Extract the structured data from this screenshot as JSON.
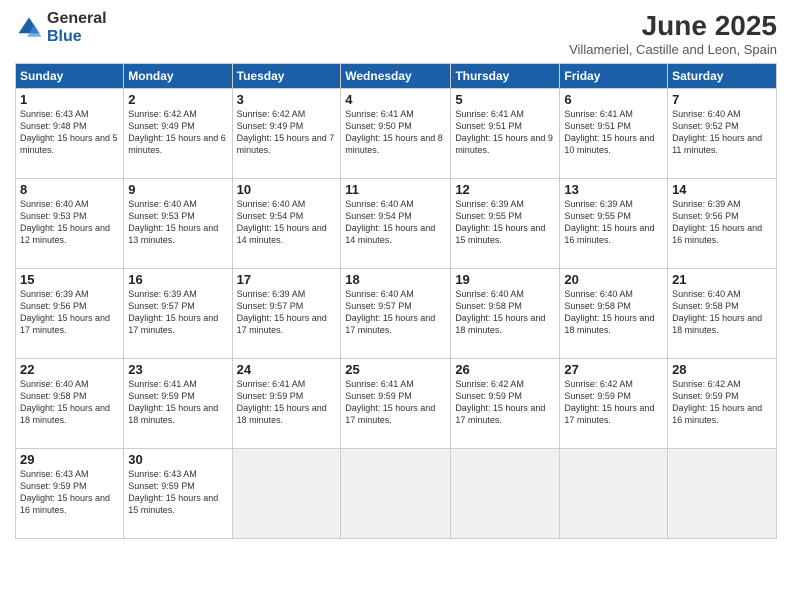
{
  "logo": {
    "general": "General",
    "blue": "Blue"
  },
  "title": "June 2025",
  "subtitle": "Villameriel, Castille and Leon, Spain",
  "days_of_week": [
    "Sunday",
    "Monday",
    "Tuesday",
    "Wednesday",
    "Thursday",
    "Friday",
    "Saturday"
  ],
  "weeks": [
    [
      {
        "day": "1",
        "sunrise": "6:43 AM",
        "sunset": "9:48 PM",
        "daylight": "15 hours and 5 minutes."
      },
      {
        "day": "2",
        "sunrise": "6:42 AM",
        "sunset": "9:49 PM",
        "daylight": "15 hours and 6 minutes."
      },
      {
        "day": "3",
        "sunrise": "6:42 AM",
        "sunset": "9:49 PM",
        "daylight": "15 hours and 7 minutes."
      },
      {
        "day": "4",
        "sunrise": "6:41 AM",
        "sunset": "9:50 PM",
        "daylight": "15 hours and 8 minutes."
      },
      {
        "day": "5",
        "sunrise": "6:41 AM",
        "sunset": "9:51 PM",
        "daylight": "15 hours and 9 minutes."
      },
      {
        "day": "6",
        "sunrise": "6:41 AM",
        "sunset": "9:51 PM",
        "daylight": "15 hours and 10 minutes."
      },
      {
        "day": "7",
        "sunrise": "6:40 AM",
        "sunset": "9:52 PM",
        "daylight": "15 hours and 11 minutes."
      }
    ],
    [
      {
        "day": "8",
        "sunrise": "6:40 AM",
        "sunset": "9:53 PM",
        "daylight": "15 hours and 12 minutes."
      },
      {
        "day": "9",
        "sunrise": "6:40 AM",
        "sunset": "9:53 PM",
        "daylight": "15 hours and 13 minutes."
      },
      {
        "day": "10",
        "sunrise": "6:40 AM",
        "sunset": "9:54 PM",
        "daylight": "15 hours and 14 minutes."
      },
      {
        "day": "11",
        "sunrise": "6:40 AM",
        "sunset": "9:54 PM",
        "daylight": "15 hours and 14 minutes."
      },
      {
        "day": "12",
        "sunrise": "6:39 AM",
        "sunset": "9:55 PM",
        "daylight": "15 hours and 15 minutes."
      },
      {
        "day": "13",
        "sunrise": "6:39 AM",
        "sunset": "9:55 PM",
        "daylight": "15 hours and 16 minutes."
      },
      {
        "day": "14",
        "sunrise": "6:39 AM",
        "sunset": "9:56 PM",
        "daylight": "15 hours and 16 minutes."
      }
    ],
    [
      {
        "day": "15",
        "sunrise": "6:39 AM",
        "sunset": "9:56 PM",
        "daylight": "15 hours and 17 minutes."
      },
      {
        "day": "16",
        "sunrise": "6:39 AM",
        "sunset": "9:57 PM",
        "daylight": "15 hours and 17 minutes."
      },
      {
        "day": "17",
        "sunrise": "6:39 AM",
        "sunset": "9:57 PM",
        "daylight": "15 hours and 17 minutes."
      },
      {
        "day": "18",
        "sunrise": "6:40 AM",
        "sunset": "9:57 PM",
        "daylight": "15 hours and 17 minutes."
      },
      {
        "day": "19",
        "sunrise": "6:40 AM",
        "sunset": "9:58 PM",
        "daylight": "15 hours and 18 minutes."
      },
      {
        "day": "20",
        "sunrise": "6:40 AM",
        "sunset": "9:58 PM",
        "daylight": "15 hours and 18 minutes."
      },
      {
        "day": "21",
        "sunrise": "6:40 AM",
        "sunset": "9:58 PM",
        "daylight": "15 hours and 18 minutes."
      }
    ],
    [
      {
        "day": "22",
        "sunrise": "6:40 AM",
        "sunset": "9:58 PM",
        "daylight": "15 hours and 18 minutes."
      },
      {
        "day": "23",
        "sunrise": "6:41 AM",
        "sunset": "9:59 PM",
        "daylight": "15 hours and 18 minutes."
      },
      {
        "day": "24",
        "sunrise": "6:41 AM",
        "sunset": "9:59 PM",
        "daylight": "15 hours and 18 minutes."
      },
      {
        "day": "25",
        "sunrise": "6:41 AM",
        "sunset": "9:59 PM",
        "daylight": "15 hours and 17 minutes."
      },
      {
        "day": "26",
        "sunrise": "6:42 AM",
        "sunset": "9:59 PM",
        "daylight": "15 hours and 17 minutes."
      },
      {
        "day": "27",
        "sunrise": "6:42 AM",
        "sunset": "9:59 PM",
        "daylight": "15 hours and 17 minutes."
      },
      {
        "day": "28",
        "sunrise": "6:42 AM",
        "sunset": "9:59 PM",
        "daylight": "15 hours and 16 minutes."
      }
    ],
    [
      {
        "day": "29",
        "sunrise": "6:43 AM",
        "sunset": "9:59 PM",
        "daylight": "15 hours and 16 minutes."
      },
      {
        "day": "30",
        "sunrise": "6:43 AM",
        "sunset": "9:59 PM",
        "daylight": "15 hours and 15 minutes."
      },
      null,
      null,
      null,
      null,
      null
    ]
  ]
}
